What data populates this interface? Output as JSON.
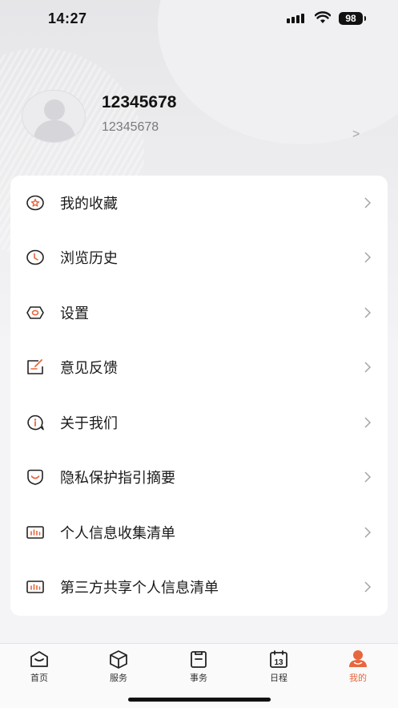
{
  "status_bar": {
    "time": "14:27",
    "battery": "98"
  },
  "profile": {
    "name": "12345678",
    "account": "12345678",
    "arrow": ">"
  },
  "menu": {
    "items": [
      {
        "label": "我的收藏",
        "icon": "favorites-star-icon"
      },
      {
        "label": "浏览历史",
        "icon": "history-clock-icon"
      },
      {
        "label": "设置",
        "icon": "settings-hexagon-icon"
      },
      {
        "label": "意见反馈",
        "icon": "feedback-edit-icon"
      },
      {
        "label": "关于我们",
        "icon": "about-info-icon"
      },
      {
        "label": "隐私保护指引摘要",
        "icon": "privacy-shield-icon"
      },
      {
        "label": "个人信息收集清单",
        "icon": "data-list-icon"
      },
      {
        "label": "第三方共享个人信息清单",
        "icon": "third-party-list-icon"
      }
    ]
  },
  "tab_bar": {
    "tabs": [
      {
        "label": "首页",
        "icon": "home-icon"
      },
      {
        "label": "服务",
        "icon": "cube-icon"
      },
      {
        "label": "事务",
        "icon": "clipboard-icon"
      },
      {
        "label": "日程",
        "icon": "calendar-icon",
        "calendar_day": "13"
      },
      {
        "label": "我的",
        "icon": "user-icon",
        "active": true
      }
    ]
  },
  "colors": {
    "accent": "#e8663d",
    "text": "#1a1a1a",
    "muted": "#7a7a7e",
    "arrow": "#a5a5aa"
  }
}
